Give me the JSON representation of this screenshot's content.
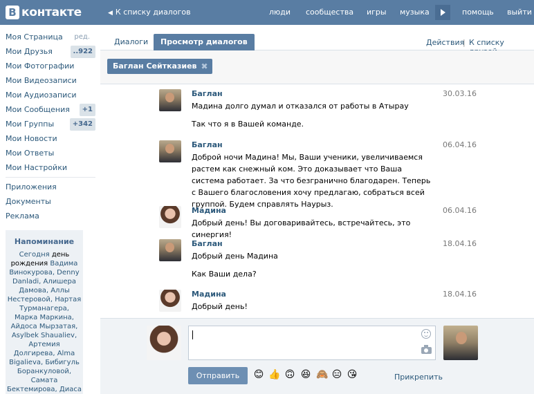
{
  "header": {
    "logo_letter": "В",
    "logo_text": "контакте",
    "back_label": "К списку диалогов",
    "nav": [
      "люди",
      "сообщества",
      "игры",
      "музыка",
      "помощь",
      "выйти"
    ]
  },
  "sidebar": {
    "items": [
      {
        "label": "Моя Страница",
        "extra": "ред."
      },
      {
        "label": "Мои Друзья",
        "badge": "..922"
      },
      {
        "label": "Мои Фотографии"
      },
      {
        "label": "Мои Видеозаписи"
      },
      {
        "label": "Мои Аудиозаписи"
      },
      {
        "label": "Мои Сообщения",
        "badge": "+1"
      },
      {
        "label": "Мои Группы",
        "badge": "+342"
      },
      {
        "label": "Мои Новости"
      },
      {
        "label": "Мои Ответы"
      },
      {
        "label": "Мои Настройки"
      }
    ],
    "extra_items": [
      "Приложения",
      "Документы",
      "Реклама"
    ],
    "reminder": {
      "title": "Напоминание",
      "prefix": "Сегодня",
      "middle": " день рождения ",
      "names": "Вадима Винокурова, Denny Danladi, Алишера Дамова, Аллы Нестеровой, Нартая Турманагера, Марка Маркина, Айдоса Мырзатая, Asylbek Shaualiev, Артемия Долгирева, Alma Bigalieva, Бибигуль Боранкуловой, Самата Бектемирова, Диаса Асинбекова,"
    }
  },
  "tabs": {
    "dialogs": "Диалоги",
    "view": "Просмотр диалогов",
    "actions": "Действия",
    "separator": "|",
    "friends": "К списку друзей"
  },
  "filter": {
    "chip": "Баглан Сейтказиев",
    "chip_remove": "✖"
  },
  "messages": [
    {
      "author": "Баглан",
      "date": "30.03.16",
      "avatar": "baglan",
      "lines": [
        "Мадина долго думал и отказался от работы в Атырау",
        "Так что я в Вашей команде."
      ]
    },
    {
      "author": "Баглан",
      "date": "06.04.16",
      "avatar": "baglan",
      "lines": [
        "Доброй ночи Мадина! Мы, Ваши ученики, увеличиваемся растем как снежный ком. Это доказывает что Ваша система работает. За что безгранично благодарен. Теперь с Вашего благословения хочу предлагаю, собраться всей группой. Будем справлять Наурыз."
      ]
    },
    {
      "author": "Мадина",
      "date": "06.04.16",
      "avatar": "madina",
      "lines": [
        "Добрый день! Вы договаривайтесь, встречайтесь, это синергия!"
      ]
    },
    {
      "author": "Баглан",
      "date": "18.04.16",
      "avatar": "baglan",
      "lines": [
        "Добрый день Мадина",
        "Как Ваши дела?"
      ]
    },
    {
      "author": "Мадина",
      "date": "18.04.16",
      "avatar": "madina",
      "lines": [
        "Добрый день!"
      ]
    }
  ],
  "composer": {
    "send_label": "Отправить",
    "attach_label": "Прикрепить",
    "emojis": [
      "😊",
      "👍",
      "🙃",
      "😆",
      "🙈",
      "😑",
      "😘"
    ],
    "icons": [
      "smile-icon",
      "camera-icon"
    ]
  },
  "colors": {
    "brand": "#597da3",
    "link": "#2b587a",
    "badge_bg": "#dae2e8"
  }
}
